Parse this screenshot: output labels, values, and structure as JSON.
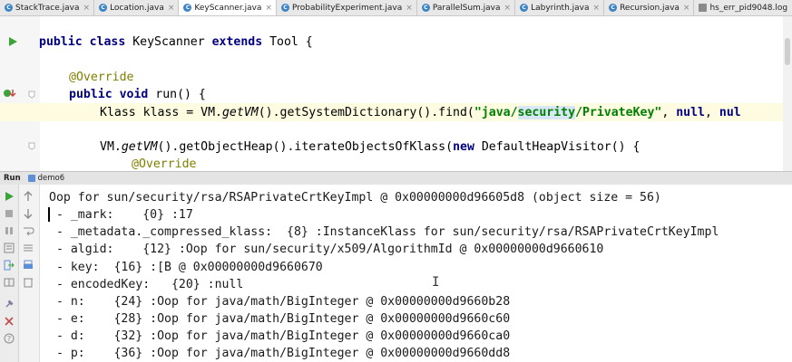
{
  "tabs": [
    {
      "label": "StackTrace.java",
      "icon": "class-icon",
      "active": false
    },
    {
      "label": "Location.java",
      "icon": "class-icon",
      "active": false
    },
    {
      "label": "KeyScanner.java",
      "icon": "class-icon",
      "active": true
    },
    {
      "label": "ProbabilityExperiment.java",
      "icon": "class-icon",
      "active": false
    },
    {
      "label": "ParallelSum.java",
      "icon": "class-icon",
      "active": false
    },
    {
      "label": "Labyrinth.java",
      "icon": "class-icon",
      "active": false
    },
    {
      "label": "Recursion.java",
      "icon": "class-icon",
      "active": false
    },
    {
      "label": "hs_err_pid9048.log",
      "icon": "log-file-icon",
      "active": false
    }
  ],
  "tab_close_glyph": "×",
  "editor": {
    "line1": {
      "kw1": "public",
      "kw2": "class",
      "name": " KeyScanner ",
      "kw3": "extends",
      "rest": " Tool {"
    },
    "line2": {
      "annotation": "@Override"
    },
    "line3": {
      "kw1": "public",
      "kw2": "void",
      "rest": " run() {"
    },
    "line4": {
      "a": "Klass klass = VM.",
      "b": "getVM",
      "c": "().getSystemDictionary().find(",
      "str1": "\"java/",
      "str_occ": "security",
      "str2": "/PrivateKey\"",
      "d": ", ",
      "kw_null1": "null",
      "e": ", ",
      "kw_null2": "nul"
    },
    "line5": {
      "a": "VM.",
      "b": "getVM",
      "c": "().getObjectHeap().iterateObjectsOfKlass(",
      "kw": "new",
      "d": " DefaultHeapVisitor() {"
    },
    "line6": {
      "annotation": "@Override"
    }
  },
  "run_panel": {
    "title": "Run",
    "config": "demo6",
    "output": [
      "Oop for sun/security/rsa/RSAPrivateCrtKeyImpl @ 0x00000000d96605d8 (object size = 56)",
      " - _mark:    {0} :17",
      " - _metadata._compressed_klass:  {8} :InstanceKlass for sun/security/rsa/RSAPrivateCrtKeyImpl",
      " - algid:    {12} :Oop for sun/security/x509/AlgorithmId @ 0x00000000d9660610",
      " - key:  {16} :[B @ 0x00000000d9660670",
      " - encodedKey:   {20} :null",
      " - n:    {24} :Oop for java/math/BigInteger @ 0x00000000d9660b28",
      " - e:    {28} :Oop for java/math/BigInteger @ 0x00000000d9660c60",
      " - d:    {32} :Oop for java/math/BigInteger @ 0x00000000d9660ca0",
      " - p:    {36} :Oop for java/math/BigInteger @ 0x00000000d9660dd8"
    ]
  },
  "colors": {
    "keyword": "#000080",
    "annotation": "#808000",
    "string": "#008000",
    "run_icon": "#3aa33a",
    "stop_icon": "#c14b4b"
  }
}
